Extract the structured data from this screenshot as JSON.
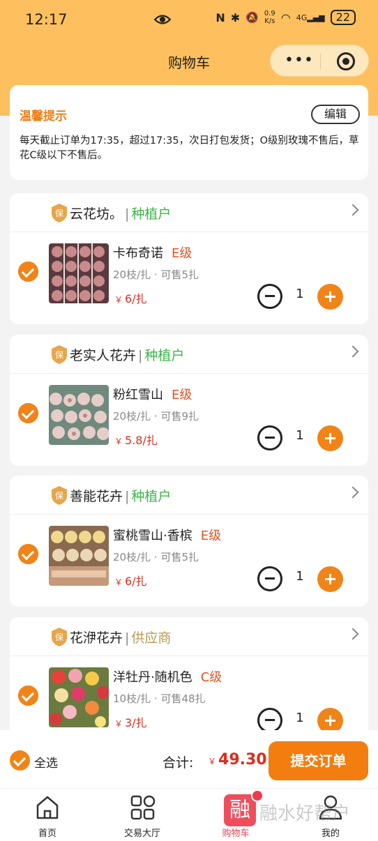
{
  "status": {
    "time": "12:17",
    "net_speed_top": "0.9",
    "net_speed_unit": "K/s",
    "battery": "22",
    "signal": "4G"
  },
  "nav": {
    "title": "购物车",
    "menu_dots": "•••"
  },
  "notice": {
    "title": "温馨提示",
    "edit": "编辑",
    "body": "每天截止订单为17:35，超过17:35，次日打包发货；O级别玫瑰不售后，草花C级以下不售后。"
  },
  "shops": [
    {
      "name": "云花坊。",
      "type": "种植户",
      "type_color": "#3cb548",
      "product": {
        "name": "卡布奇诺",
        "grade": "E级",
        "spec": "20枝/扎 · 可售5扎",
        "currency": "￥",
        "price": "6/扎",
        "qty": "1"
      }
    },
    {
      "name": "老实人花卉",
      "type": "种植户",
      "type_color": "#3cb548",
      "product": {
        "name": "粉红雪山",
        "grade": "E级",
        "spec": "20枝/扎 · 可售9扎",
        "currency": "￥",
        "price": "5.8/扎",
        "qty": "1"
      }
    },
    {
      "name": "善能花卉",
      "type": "种植户",
      "type_color": "#3cb548",
      "product": {
        "name": "蜜桃雪山·香槟",
        "grade": "E级",
        "spec": "20枝/扎 · 可售5扎",
        "currency": "￥",
        "price": "6/扎",
        "qty": "1"
      }
    },
    {
      "name": "花洢花卉",
      "type": "供应商",
      "type_color": "#b89a4e",
      "product": {
        "name": "洋牡丹·随机色",
        "grade": "C级",
        "spec": "10枝/扎 · 可售48扎",
        "currency": "￥",
        "price": "3/扎",
        "qty": "1"
      }
    }
  ],
  "footer": {
    "select_all": "全选",
    "total_label": "合计:",
    "currency": "￥",
    "total": "49.30",
    "submit": "提交订单"
  },
  "tabs": [
    {
      "label": "首页",
      "icon": "home-icon"
    },
    {
      "label": "交易大厅",
      "icon": "grid-icon"
    },
    {
      "label": "购物车",
      "icon": "cart-app-icon",
      "glyph": "融"
    },
    {
      "label": "我的",
      "icon": "user-icon"
    }
  ],
  "watermark": "融水好帮户",
  "colors": {
    "brand_orange": "#f08419",
    "header_yellow": "#fec05e",
    "price_red": "#e02b1d",
    "grade_red": "#e8501e",
    "notice_orange": "#ef7d16"
  }
}
